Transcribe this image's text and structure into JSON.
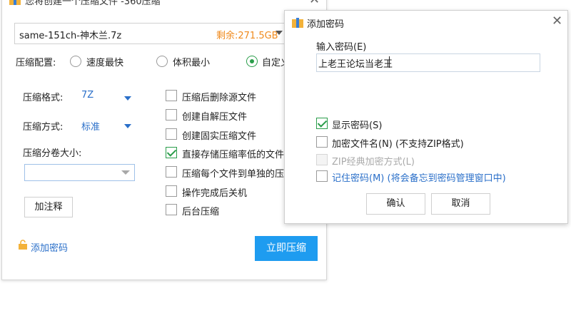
{
  "main": {
    "title": "您将创建一个压缩文件 -360压缩",
    "file_name": "same-151ch-神木兰.7z",
    "free_space": "剩余:271.5GB",
    "config_label": "压缩配置:",
    "radios": [
      {
        "label": "速度最快",
        "selected": false
      },
      {
        "label": "体积最小",
        "selected": false
      },
      {
        "label": "自定义",
        "selected": true
      }
    ],
    "format_label": "压缩格式:",
    "format_value": "7Z",
    "method_label": "压缩方式:",
    "method_value": "标准",
    "split_label": "压缩分卷大小:",
    "comment_button": "加注释",
    "checkboxes": [
      {
        "label": "压缩后删除源文件",
        "checked": false
      },
      {
        "label": "创建自解压文件",
        "checked": false
      },
      {
        "label": "创建固实压缩文件",
        "checked": false
      },
      {
        "label": "直接存储压缩率低的文件",
        "checked": true
      },
      {
        "label": "压缩每个文件到单独的压缩",
        "checked": false
      },
      {
        "label": "操作完成后关机",
        "checked": false
      },
      {
        "label": "后台压缩",
        "checked": false
      }
    ],
    "add_password_link": "添加密码",
    "compress_button": "立即压缩"
  },
  "password_dialog": {
    "title": "添加密码",
    "input_label": "输入密码(E)",
    "password_value": "上老王论坛当老王",
    "options": [
      {
        "label": "显示密码(S)",
        "checked": true,
        "disabled": false
      },
      {
        "label": "加密文件名(N) (不支持ZIP格式)",
        "checked": false,
        "disabled": false
      },
      {
        "label": "ZIP经典加密方式(L)",
        "checked": false,
        "disabled": true
      },
      {
        "label": "记住密码(M) (将会备忘到密码管理窗口中)",
        "checked": false,
        "disabled": false
      }
    ],
    "ok_button": "确认",
    "cancel_button": "取消"
  },
  "colors": {
    "accent_blue": "#1e9cf0",
    "link_blue": "#2a6fc9",
    "check_green": "#2a9d4a",
    "free_orange": "#f08a1c"
  }
}
